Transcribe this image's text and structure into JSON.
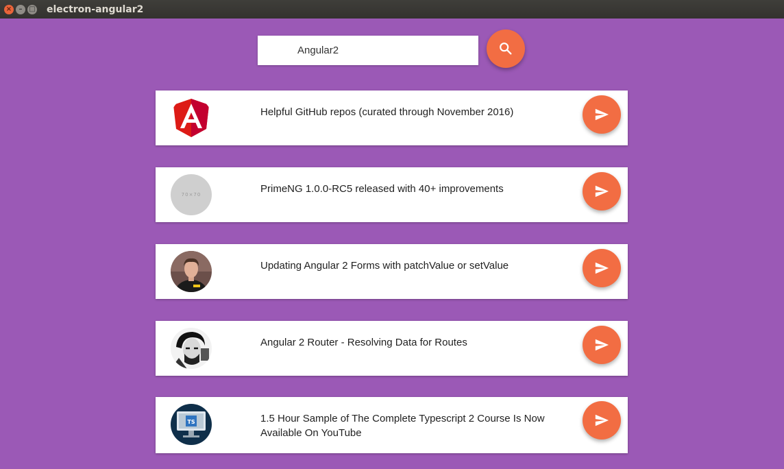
{
  "window": {
    "title": "electron-angular2",
    "close_glyph": "×",
    "min_glyph": "–",
    "max_glyph": "□"
  },
  "search": {
    "value": "Angular2",
    "button_icon": "search-icon"
  },
  "colors": {
    "background": "#9b59b6",
    "accent": "#f26d43",
    "card": "#ffffff",
    "text": "#212121"
  },
  "results": [
    {
      "title": "Helpful GitHub repos (curated through November 2016)",
      "avatar": "angular-logo",
      "action_icon": "send-icon"
    },
    {
      "title": "PrimeNG 1.0.0-RC5 released with 40+ improvements",
      "avatar": "placeholder",
      "avatar_text": "70×70",
      "action_icon": "send-icon"
    },
    {
      "title": "Updating Angular 2 Forms with patchValue or setValue",
      "avatar": "person-photo",
      "action_icon": "send-icon"
    },
    {
      "title": "Angular 2 Router - Resolving Data for Routes",
      "avatar": "sketch-portrait",
      "action_icon": "send-icon"
    },
    {
      "title": "1.5 Hour Sample of The Complete Typescript 2 Course Is Now Available On YouTube",
      "avatar": "typescript-monitor",
      "avatar_text": "TS",
      "action_icon": "send-icon"
    }
  ]
}
